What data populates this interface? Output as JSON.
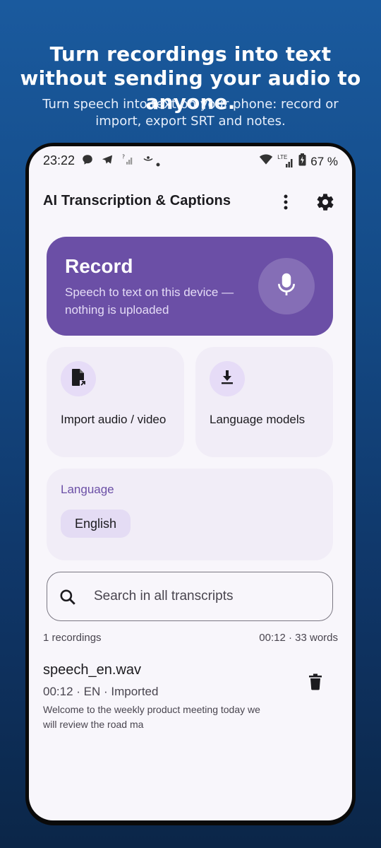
{
  "promo": {
    "title": "Turn recordings into text without sending your audio to anyone.",
    "subtitle": "Turn speech into text on your phone: record or import, export SRT and notes."
  },
  "status_bar": {
    "time": "23:22",
    "battery": "67 %",
    "network": "LTE",
    "icons": [
      "chat-icon",
      "telegram-icon",
      "signal-off-icon",
      "cast-icon",
      "dot-icon",
      "wifi-icon",
      "signal-icon",
      "battery-charging-icon"
    ]
  },
  "appbar": {
    "title": "AI Transcription & Captions",
    "icons": [
      "more-vert-icon",
      "settings-icon"
    ]
  },
  "record_card": {
    "title": "Record",
    "subtitle": "Speech to text on this device — nothing is uploaded",
    "icon": "mic-icon",
    "color": "#6b4fa6"
  },
  "tiles": [
    {
      "label": "Import audio / video",
      "icon": "file-import-icon"
    },
    {
      "label": "Language models",
      "icon": "download-icon"
    }
  ],
  "language": {
    "label": "Language",
    "selected": "English"
  },
  "search": {
    "placeholder": "Search in all transcripts",
    "icon": "search-icon"
  },
  "summary": {
    "count": "1 recordings",
    "totals": "00:12 · 33 words"
  },
  "recordings": [
    {
      "name": "speech_en.wav",
      "info": "00:12 · EN · Imported",
      "preview": "Welcome to the weekly product meeting today we will review the road ma"
    }
  ]
}
